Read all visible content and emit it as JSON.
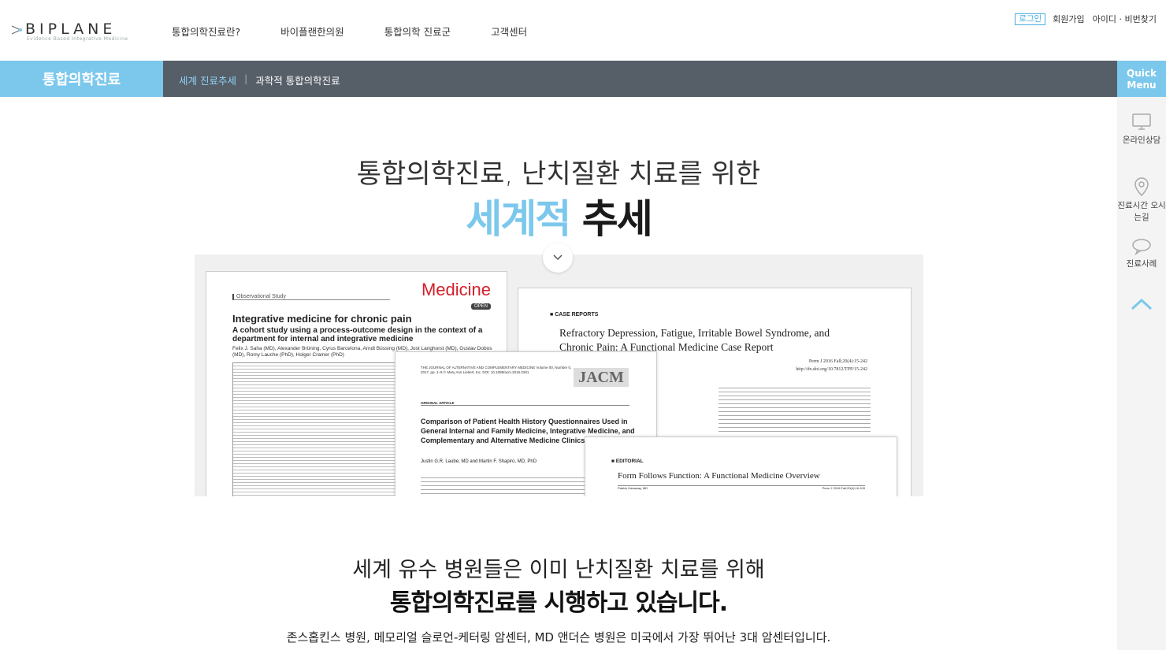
{
  "header": {
    "logo_text": "BIPLANE",
    "logo_sub": "Evidence Based Integrative Medicine",
    "nav": [
      "통합의학진료란?",
      "바이플랜한의원",
      "통합의학 진료군",
      "고객센터"
    ],
    "util": {
      "login": "로그인",
      "signup": "회원가입",
      "find": "아이디 · 비번찾기"
    }
  },
  "subbar": {
    "title": "통합의학진료",
    "crumbs": [
      "세계 진료추세",
      "과학적 통합의학진료"
    ]
  },
  "quick": {
    "title_1": "Quick",
    "title_2": "Menu",
    "items": [
      "온라인상담",
      "진료시간 오시는길",
      "진료사례"
    ]
  },
  "main": {
    "headline1": "통합의학진료, 난치질환 치료를 위한",
    "headline2_highlight": "세계적",
    "headline2_dark": "추세",
    "sec1": "세계 유수 병원들은 이미 난치질환 치료를 위해",
    "sec2": "통합의학진료를 시행하고 있습니다.",
    "sec3": "존스홉킨스 병원, 메모리얼 슬로언-케터링 암센터, MD 앤더슨 병원은 미국에서 가장 뛰어난 3대 암센터입니다."
  },
  "papers": {
    "p1": {
      "type": "Observational Study",
      "brand": "Medicine",
      "badge": "OPEN",
      "title": "Integrative medicine for chronic pain",
      "subtitle": "A cohort study using a process-outcome design in the context of a department for internal and integrative medicine",
      "authors": "Felix J. Saha (MD), Alexander Brüning, Cyrus Barcelona, Arndt Büssing (MD), Jost Langhorst (MD), Gustav Dobos (MD), Romy Lauche (PhD), Holger Cramer (PhD)"
    },
    "p2": {
      "label": "CASE REPORTS",
      "title": "Refractory Depression, Fatigue, Irritable Bowel Syndrome, and Chronic Pain: A Functional Medicine Case Report",
      "meta1": "Perm J 2016 Fall;20(4):15-242",
      "meta2": "http://dx.doi.org/10.7812/TPP/15-242"
    },
    "p3": {
      "journal": "THE JOURNAL OF ALTERNATIVE AND COMPLEMENTARY MEDICINE Volume 00, Number 0, 2017, pp. 1–9 © Mary Ann Liebert, Inc. DOI: 10.1089/acm.2016.0281",
      "logo": "JACM",
      "article_type": "ORIGINAL ARTICLE",
      "title": "Comparison of Patient Health History Questionnaires Used in General Internal and Family Medicine, Integrative Medicine, and Complementary and Alternative Medicine Clinics",
      "authors": "Justin G.R. Laube, MD and Martin F. Shapiro, MD, PhD"
    },
    "p4": {
      "label": "EDITORIAL",
      "title": "Form Follows Function: A Functional Medicine Overview",
      "author": "Patrick Hanaway, MD",
      "meta": "Perm J 2016 Fall;20(4):16-109"
    }
  },
  "colors": {
    "accent": "#7cc8ec",
    "subbar": "#565e68",
    "brand_red": "#d41f2b"
  }
}
